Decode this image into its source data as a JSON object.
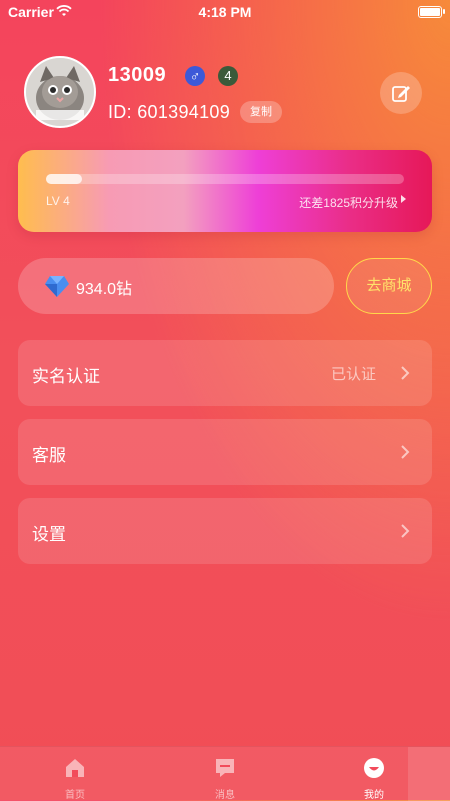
{
  "status_bar": {
    "carrier": "Carrier",
    "time": "4:18 PM"
  },
  "profile": {
    "username": "13009",
    "gender_symbol": "♂",
    "level_badge": "4",
    "id_text": "ID: 601394109",
    "copy_label": "复制"
  },
  "level": {
    "label": "LV 4",
    "progress_text": "还差1825积分升级",
    "progress_fraction": 0.1
  },
  "wallet": {
    "balance": "934.0钻",
    "shop_label": "去商城"
  },
  "menu": {
    "items": [
      {
        "label": "实名认证",
        "value": "已认证"
      },
      {
        "label": "客服",
        "value": ""
      },
      {
        "label": "设置",
        "value": ""
      }
    ]
  },
  "tabbar": {
    "tabs": [
      {
        "label": "首页",
        "icon": "home-icon"
      },
      {
        "label": "消息",
        "icon": "message-icon"
      },
      {
        "label": "我的",
        "icon": "profile-icon",
        "active": true
      }
    ]
  },
  "colors": {
    "background_top": "#f4445c",
    "accent_orange": "#f78a3a",
    "shop_button": "#ffd84a",
    "gender_badge": "#3d59d8"
  }
}
